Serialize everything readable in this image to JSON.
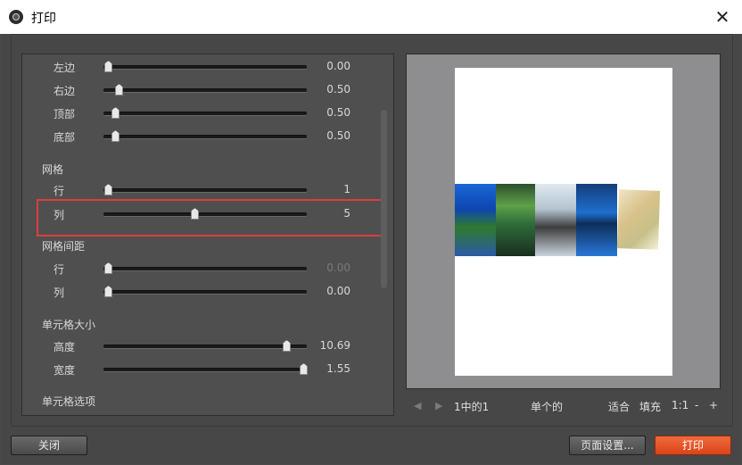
{
  "window": {
    "title": "打印",
    "close_glyph": "✕"
  },
  "settings": {
    "margins": [
      {
        "label": "左边",
        "value": "0.00",
        "level": 0.0
      },
      {
        "label": "右边",
        "value": "0.50",
        "level": 0.05
      },
      {
        "label": "顶部",
        "value": "0.50",
        "level": 0.05
      },
      {
        "label": "底部",
        "value": "0.50",
        "level": 0.05
      }
    ],
    "grid": {
      "heading": "网格",
      "rows": {
        "label": "行",
        "value": "1",
        "level": 0.0
      },
      "cols": {
        "label": "列",
        "value": "5",
        "level": 0.45
      }
    },
    "grid_spacing": {
      "heading": "网格间距",
      "rows": {
        "label": "行",
        "value": "0.00",
        "level": 0.0
      },
      "cols": {
        "label": "列",
        "value": "0.00",
        "level": 0.0
      }
    },
    "cell_size": {
      "heading": "单元格大小",
      "height": {
        "label": "高度",
        "value": "10.69",
        "level": 0.9
      },
      "width": {
        "label": "宽度",
        "value": "1.55",
        "level": 1.0
      }
    },
    "cell_options": {
      "heading": "单元格选项"
    }
  },
  "pager": {
    "page_info": "1中的1",
    "mode": "单个的",
    "fit": "适合",
    "fill": "填充",
    "ratio": "1:1",
    "minus": "-",
    "plus": "+"
  },
  "buttons": {
    "close": "关闭",
    "page_setup": "页面设置...",
    "print": "打印"
  },
  "colors": {
    "accent": "#e8562a",
    "highlight": "#e03c3c"
  }
}
